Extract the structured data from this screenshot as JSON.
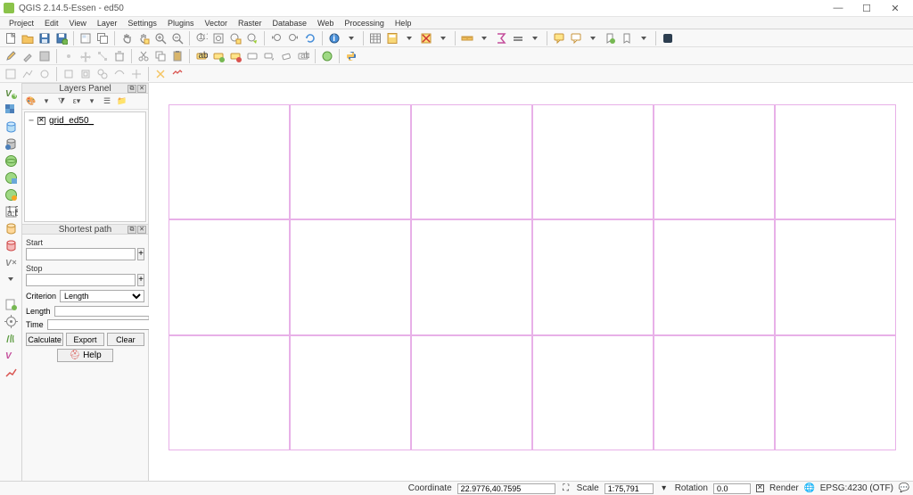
{
  "window": {
    "title": "QGIS 2.14.5-Essen - ed50"
  },
  "menu": [
    "Project",
    "Edit",
    "View",
    "Layer",
    "Settings",
    "Plugins",
    "Vector",
    "Raster",
    "Database",
    "Web",
    "Processing",
    "Help"
  ],
  "panels": {
    "layers": {
      "title": "Layers Panel",
      "items": [
        {
          "name": "grid_ed50_",
          "checked": true
        }
      ]
    },
    "shortest_path": {
      "title": "Shortest path",
      "start_label": "Start",
      "start_value": "",
      "stop_label": "Stop",
      "stop_value": "",
      "criterion_label": "Criterion",
      "criterion_value": "Length",
      "length_label": "Length",
      "length_value": "",
      "time_label": "Time",
      "time_value": "",
      "buttons": {
        "calculate": "Calculate",
        "export": "Export",
        "clear": "Clear",
        "help": "Help"
      }
    }
  },
  "status": {
    "coordinate_label": "Coordinate",
    "coordinate_value": "22.9776,40.7595",
    "scale_label": "Scale",
    "scale_value": "1:75,791",
    "rotation_label": "Rotation",
    "rotation_value": "0.0",
    "render_label": "Render",
    "crs_label": "EPSG:4230 (OTF)"
  }
}
